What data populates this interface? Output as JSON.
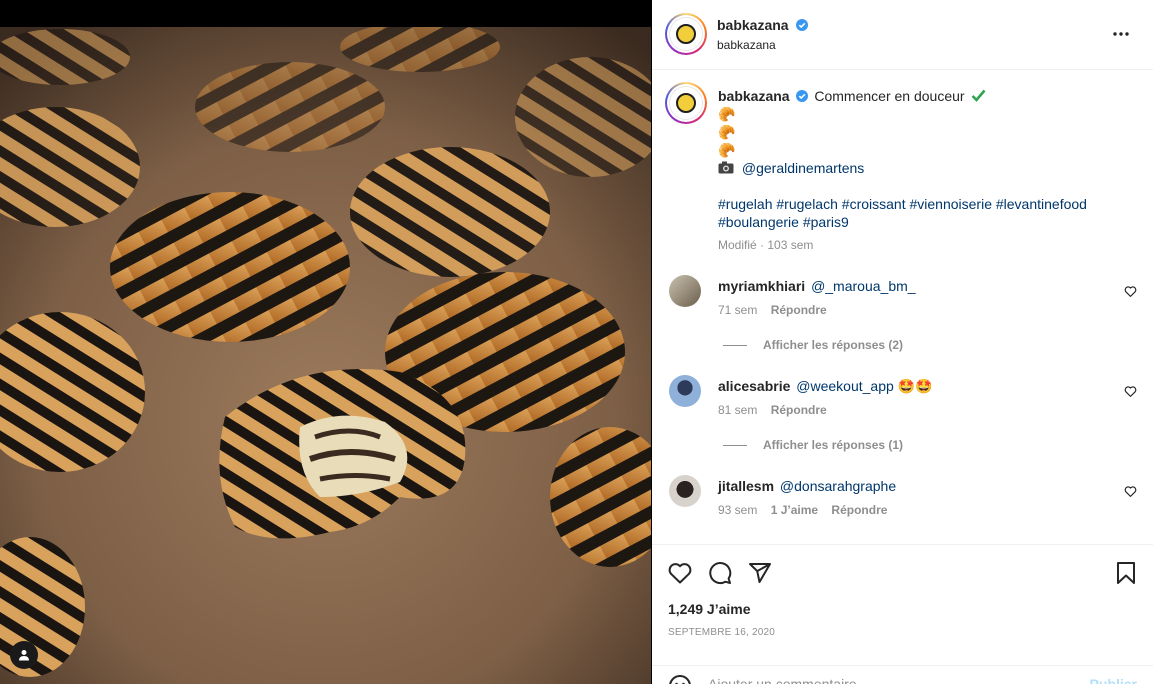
{
  "post": {
    "username": "babkazana",
    "subtitle": "babkazana",
    "caption_text": "Commencer en douceur",
    "caption_emojis": [
      "🥐",
      "🥐",
      "🥐"
    ],
    "photo_credit": "@geraldinemartens",
    "hashtags_line1": [
      "#rugelah",
      "#rugelach",
      "#croissant",
      "#viennoiserie",
      "#levantinefood"
    ],
    "hashtags_line2": [
      "#boulangerie",
      "#paris9"
    ],
    "edited": "Modifié",
    "edited_age": "103 sem",
    "likes": "1,249 J’aime",
    "date": "SEPTEMBRE 16, 2020",
    "comment_placeholder": "Ajouter un commentaire",
    "publish_label": "Publier"
  },
  "comments": [
    {
      "user": "myriamkhiari",
      "mention": "@_maroua_bm_",
      "emojis": "",
      "age": "71 sem",
      "likes": "",
      "reply": "Répondre",
      "show_replies": "Afficher les réponses (2)"
    },
    {
      "user": "alicesabrie",
      "mention": "@weekout_app",
      "emojis": "🤩🤩",
      "age": "81 sem",
      "likes": "",
      "reply": "Répondre",
      "show_replies": "Afficher les réponses (1)"
    },
    {
      "user": "jitallesm",
      "mention": "@donsarahgraphe",
      "emojis": "",
      "age": "93 sem",
      "likes": "1 J’aime",
      "reply": "Répondre",
      "show_replies": ""
    }
  ],
  "colors": {
    "verified": "#3897f0",
    "link": "#00376b",
    "muted": "#8e8e8e",
    "check": "#2ea44f"
  },
  "icons": [
    "verified-badge-icon",
    "more-options-icon",
    "camera-icon",
    "heart-icon",
    "comment-icon",
    "share-icon",
    "bookmark-icon",
    "user-tag-icon",
    "emoji-icon"
  ]
}
